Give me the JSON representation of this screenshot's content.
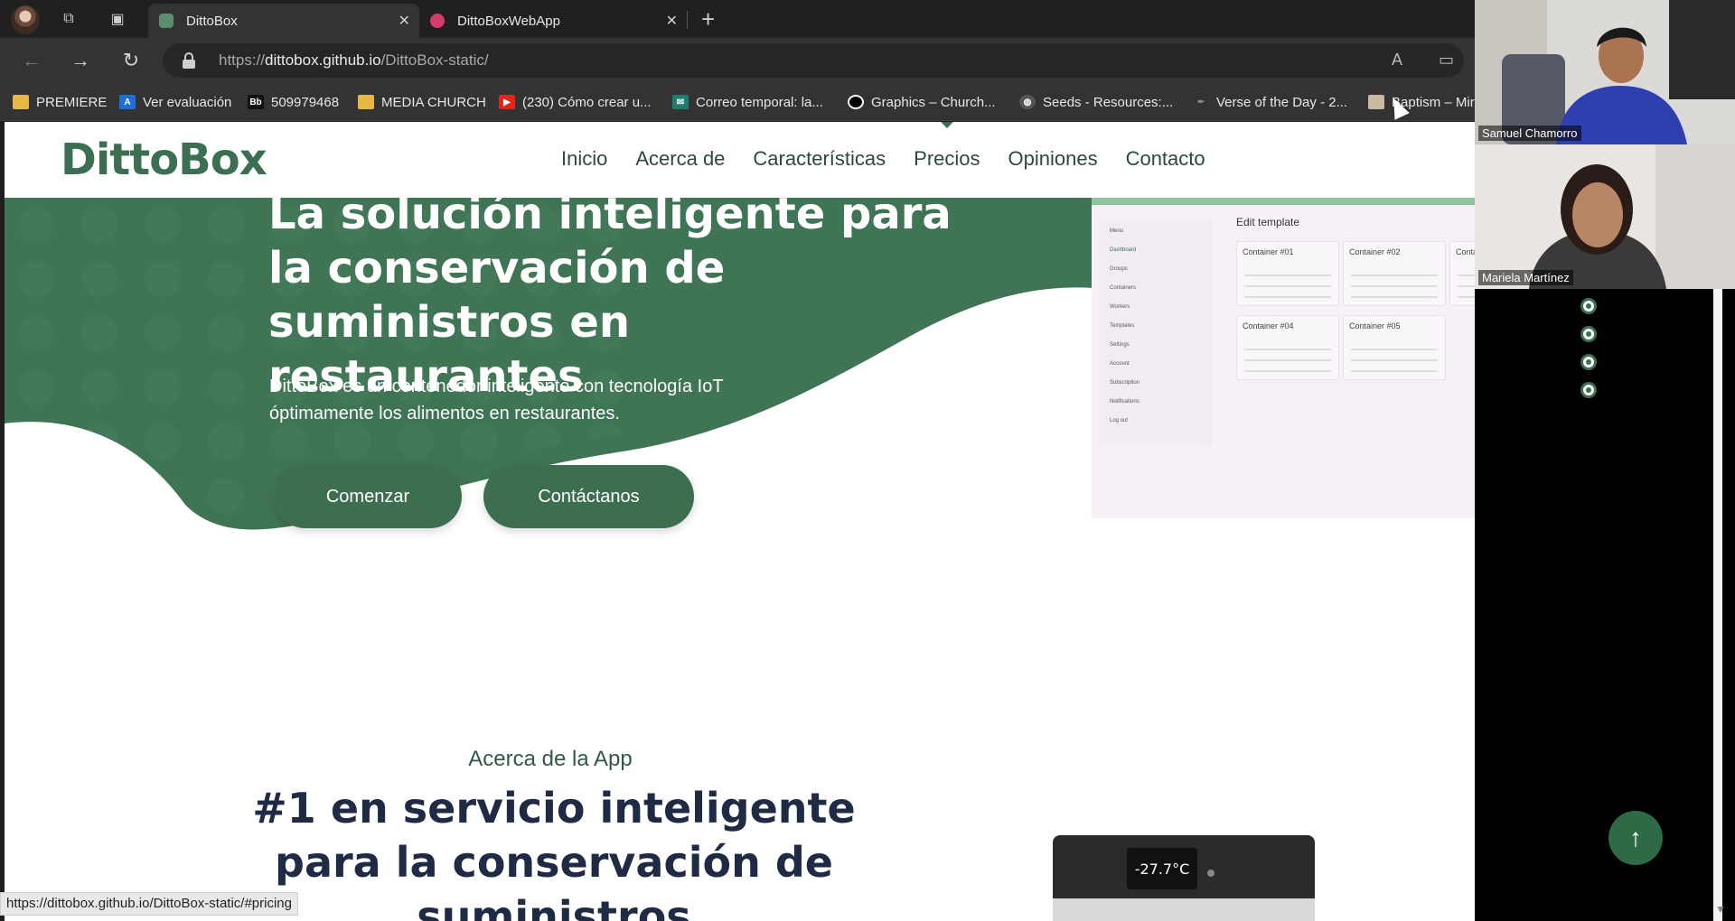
{
  "tabs": [
    {
      "title": "DittoBox",
      "active": true
    },
    {
      "title": "DittoBoxWebApp",
      "active": false
    }
  ],
  "address": {
    "prefix": "https://",
    "host": "dittobox.github.io",
    "path": "/DittoBox-static/"
  },
  "bookmarks": [
    {
      "label": "PREMIERE",
      "icon": "folder-icon"
    },
    {
      "label": "Ver evaluación",
      "icon": "a-logo-icon"
    },
    {
      "label": "509979468",
      "icon": "bb-icon"
    },
    {
      "label": "MEDIA CHURCH",
      "icon": "folder-icon"
    },
    {
      "label": "(230) Cómo crear u...",
      "icon": "youtube-icon"
    },
    {
      "label": "Correo temporal: la...",
      "icon": "mail-icon"
    },
    {
      "label": "Graphics – Church...",
      "icon": "circle-icon"
    },
    {
      "label": "Seeds - Resources:...",
      "icon": "globe-icon"
    },
    {
      "label": "Verse of the Day - 2...",
      "icon": "feather-icon"
    },
    {
      "label": "Baptism – Mir",
      "icon": "image-icon"
    }
  ],
  "site": {
    "logo": "DittoBox",
    "menu": [
      "Inicio",
      "Acerca de",
      "Características",
      "Precios",
      "Opiniones",
      "Contacto"
    ],
    "hero_title": "La solución inteligente para la conservación de suministros en restaurantes",
    "hero_desc": "DittoBox es un contenedor inteligente con tecnología IoT óptimamente los alimentos en restaurantes.",
    "btn_start": "Comenzar",
    "btn_contact": "Contáctanos",
    "mockup": {
      "edit_label": "Edit template",
      "side_items": [
        "Menu",
        "Dashboard",
        "Groups",
        "Containers",
        "Workers",
        "Templates",
        "Settings",
        "Account",
        "Subscription",
        "Notifications",
        "Log out"
      ],
      "cards": [
        "Container #01",
        "Container #02",
        "Conta",
        "Container #04",
        "Container #05"
      ]
    },
    "about_sub": "Acerca de la App",
    "about_title": "#1 en servicio inteligente para la conservación de suministros",
    "fridge_display": "-27.7°C"
  },
  "status_url": "https://dittobox.github.io/DittoBox-static/#pricing",
  "participants": [
    "Samuel Chamorro",
    "Mariela Martínez"
  ],
  "colors": {
    "brand_green": "#3c6e52",
    "hero_green": "#3f7455"
  }
}
